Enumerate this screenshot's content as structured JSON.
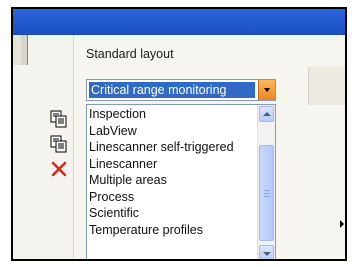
{
  "dialog": {
    "standard_layout_label": "Standard layout",
    "combo_selected": "Critical range monitoring",
    "layouts": [
      "Inspection",
      "LabView",
      "Linescanner self-triggered",
      "Linescanner",
      "Multiple areas",
      "Process",
      "Scientific",
      "Temperature profiles"
    ]
  },
  "icons": {
    "toolbar": [
      "copy-layout-icon",
      "paste-layout-icon",
      "delete-icon"
    ],
    "submenu": "chevron-right-icon"
  },
  "colors": {
    "title_bar": "#1a4fc1",
    "selection": "#316ac5",
    "combo_button": "#e8871e",
    "delete_icon": "#d62718"
  }
}
